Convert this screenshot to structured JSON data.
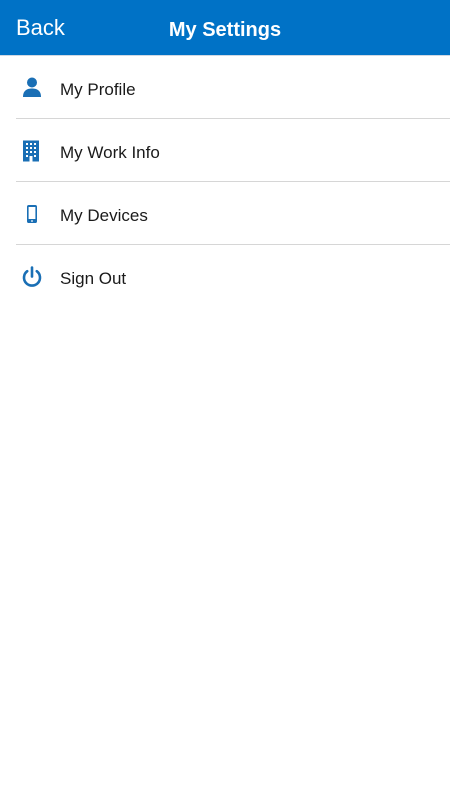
{
  "header": {
    "back_label": "Back",
    "title": "My Settings",
    "background_color": "#0072c6"
  },
  "menu": {
    "icon_color": "#1a6fb5",
    "items": [
      {
        "label": "My Profile",
        "icon": "person-icon"
      },
      {
        "label": "My Work Info",
        "icon": "building-icon"
      },
      {
        "label": "My Devices",
        "icon": "phone-icon"
      },
      {
        "label": "Sign Out",
        "icon": "power-icon"
      }
    ]
  }
}
